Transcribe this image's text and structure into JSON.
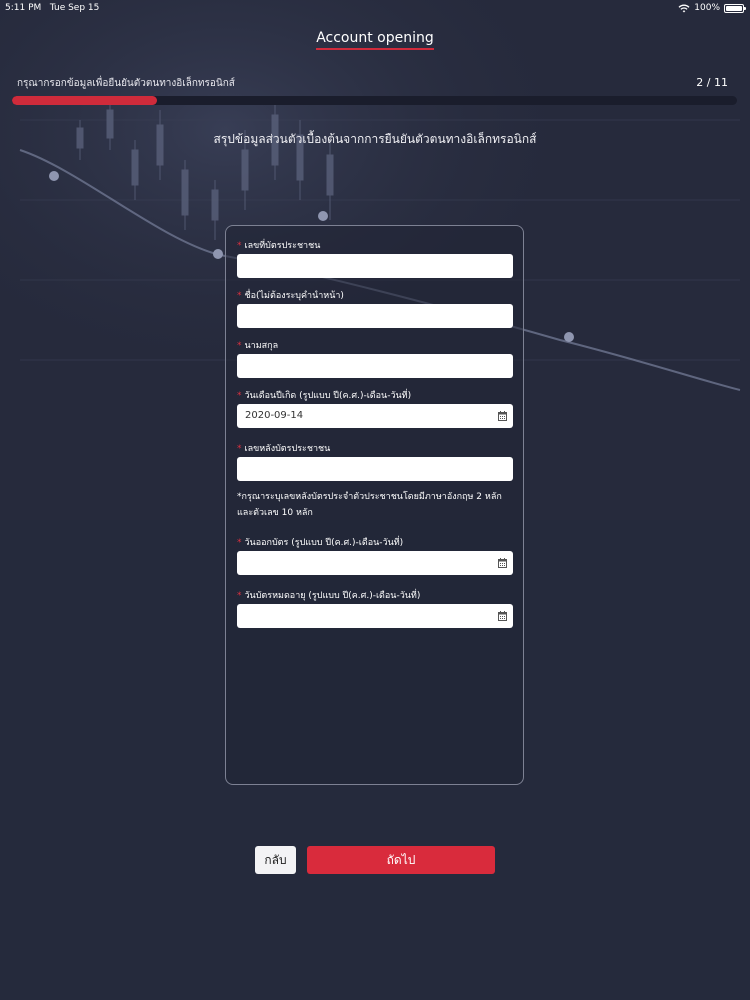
{
  "status_bar": {
    "time": "5:11 PM",
    "date": "Tue Sep 15",
    "battery": "100%",
    "wifi_icon": "wifi-icon",
    "battery_icon": "battery-icon"
  },
  "header": {
    "title": "Account opening"
  },
  "step": {
    "label": "กรุณากรอกข้อมูลเพื่อยืนยันตัวตนทางอิเล็กทรอนิกส์",
    "count": "2 / 11",
    "progress": 0.2
  },
  "section_title": "สรุปข้อมูลส่วนตัวเบื้องต้นจากการยืนยันตัวตนทางอิเล็กทรอนิกส์",
  "form": {
    "fields": [
      {
        "label": "เลขที่บัตรประชาชน",
        "value": "",
        "required": "*"
      },
      {
        "label": "ชื่อ(ไม่ต้องระบุคำนำหน้า)",
        "value": "",
        "required": "*"
      },
      {
        "label": "นามสกุล",
        "value": "",
        "required": "*"
      },
      {
        "label": "วันเดือนปีเกิด (รูปแบบ ปี(ค.ศ.)-เดือน-วันที่)",
        "value": "2020-09-14",
        "required": "*"
      },
      {
        "label": "เลขหลังบัตรประชาชน",
        "value": "",
        "required": "*"
      },
      {
        "label": "วันออกบัตร (รูปแบบ ปี(ค.ศ.)-เดือน-วันที่)",
        "value": "",
        "required": "*"
      },
      {
        "label": "วันบัตรหมดอายุ (รูปแบบ ปี(ค.ศ.)-เดือน-วันที่)",
        "value": "",
        "required": "*"
      }
    ],
    "note_line1": "*กรุณาระบุเลขหลังบัตรประจำตัวประชาชนโดยมีภาษาอังกฤษ 2 หลัก",
    "note_line2": "และตัวเลข 10 หลัก",
    "calendar_icon": "calendar-icon"
  },
  "buttons": {
    "back": "กลับ",
    "next": "ถัดไป"
  },
  "colors": {
    "accent": "#d92b3c",
    "background": "#262a3c",
    "progress_track": "#1a1d2c"
  }
}
